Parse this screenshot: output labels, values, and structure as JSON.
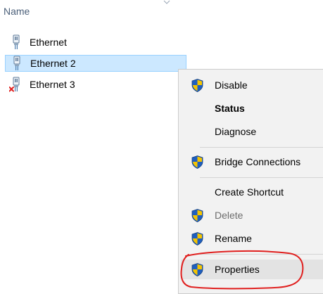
{
  "header": {
    "name_column": "Name"
  },
  "connections": [
    {
      "label": "Ethernet",
      "icon": "network-adapter-icon",
      "state": "normal"
    },
    {
      "label": "Ethernet 2",
      "icon": "network-adapter-icon",
      "state": "selected"
    },
    {
      "label": "Ethernet 3",
      "icon": "network-adapter-disconnected-icon",
      "state": "disconnected"
    }
  ],
  "context_menu": {
    "items": [
      {
        "label": "Disable",
        "icon": "uac-shield-icon",
        "style": "normal"
      },
      {
        "label": "Status",
        "icon": "",
        "style": "bold"
      },
      {
        "label": "Diagnose",
        "icon": "",
        "style": "normal"
      },
      {
        "label": "Bridge Connections",
        "icon": "uac-shield-icon",
        "style": "normal"
      },
      {
        "label": "Create Shortcut",
        "icon": "",
        "style": "normal"
      },
      {
        "label": "Delete",
        "icon": "uac-shield-icon",
        "style": "disabled"
      },
      {
        "label": "Rename",
        "icon": "uac-shield-icon",
        "style": "normal"
      },
      {
        "label": "Properties",
        "icon": "uac-shield-icon",
        "style": "hover"
      }
    ]
  },
  "colors": {
    "selection_bg": "#cce8ff",
    "selection_border": "#99d1ff",
    "menu_bg": "#f2f2f2",
    "annotation_red": "#e0201f",
    "shield_blue": "#1f5fbf",
    "shield_yellow": "#f5c400"
  }
}
